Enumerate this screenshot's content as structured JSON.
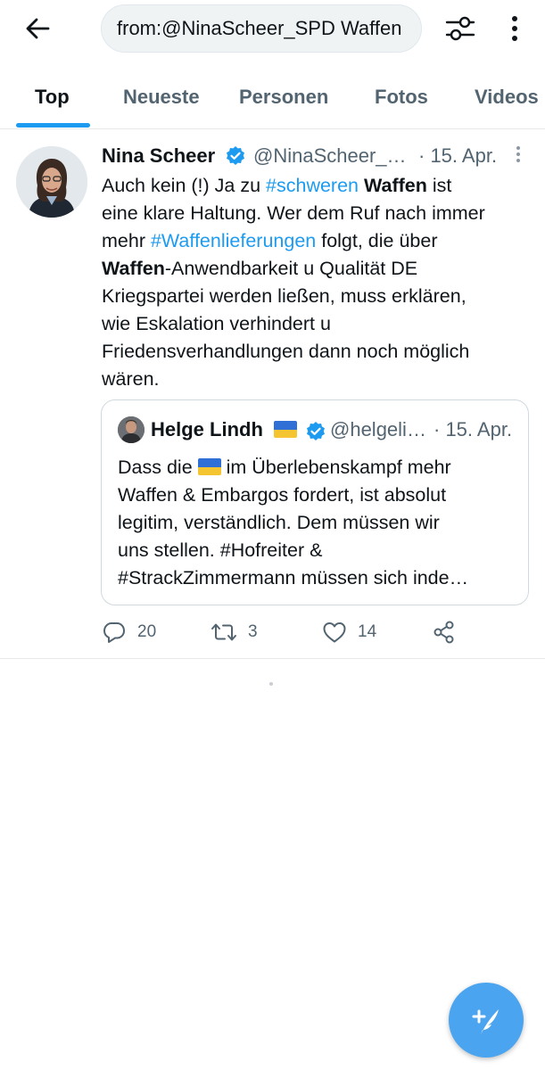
{
  "search": {
    "query": "from:@NinaScheer_SPD Waffen"
  },
  "tabs": [
    {
      "label": "Top",
      "active": true
    },
    {
      "label": "Neueste"
    },
    {
      "label": "Personen"
    },
    {
      "label": "Fotos"
    },
    {
      "label": "Videos"
    }
  ],
  "tweet": {
    "author_name": "Nina Scheer",
    "handle": "@NinaScheer_…",
    "date": "· 15. Apr.",
    "text_segments": {
      "l1_a": "Auch kein (!) Ja zu ",
      "l1_hashtag": "#schweren",
      "l1_space": " ",
      "l1_bold": "Waffen",
      "l1_b": " ist",
      "l2": "eine klare Haltung. Wer dem Ruf nach immer",
      "l3_a": "mehr ",
      "l3_hashtag": "#Waffenlieferungen",
      "l3_b": " folgt, die über",
      "l4_bold": "Waffen",
      "l4_b": "-Anwendbarkeit u Qualität DE",
      "l5": "Kriegspartei werden ließen, muss erklären,",
      "l6": "wie Eskalation verhindert u",
      "l7": "Friedensverhandlungen dann noch möglich",
      "l8": "wären."
    },
    "quote": {
      "author_name": "Helge Lindh",
      "handle": "@helgeli…",
      "date": "· 15. Apr.",
      "text_segments": {
        "l1_a": "Dass die ",
        "l1_b": " im Überlebenskampf mehr",
        "l2": "Waffen & Embargos fordert, ist absolut",
        "l3": "legitim, verständlich. Dem müssen wir",
        "l4": "uns stellen. #Hofreiter &",
        "l5": "#StrackZimmermann müssen sich inde…"
      }
    },
    "actions": {
      "replies": "20",
      "retweets": "3",
      "likes": "14"
    }
  },
  "colors": {
    "accent": "#1d9bf0",
    "secondary_text": "#536471",
    "fab": "#4aa4ef",
    "flag_blue": "#2f6fd6",
    "flag_yellow": "#f4c531"
  }
}
